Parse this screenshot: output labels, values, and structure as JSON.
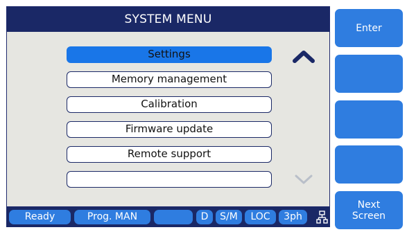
{
  "title": "SYSTEM MENU",
  "menu": {
    "items": [
      {
        "label": "Settings",
        "selected": true
      },
      {
        "label": "Memory management",
        "selected": false
      },
      {
        "label": "Calibration",
        "selected": false
      },
      {
        "label": "Firmware update",
        "selected": false
      },
      {
        "label": "Remote support",
        "selected": false
      },
      {
        "label": "",
        "selected": false
      }
    ],
    "scroll_up_icon": "chevron-up-icon",
    "scroll_down_icon": "chevron-down-icon"
  },
  "status_bar": {
    "items": [
      {
        "id": "ready",
        "label": "Ready"
      },
      {
        "id": "prog",
        "label": "Prog. MAN"
      },
      {
        "id": "blank",
        "label": ""
      },
      {
        "id": "d",
        "label": "D"
      },
      {
        "id": "sm",
        "label": "S/M"
      },
      {
        "id": "loc",
        "label": "LOC"
      },
      {
        "id": "phase",
        "label": "3ph"
      }
    ],
    "network_icon": "network-icon"
  },
  "softkeys": {
    "enter": "Enter",
    "key2": "",
    "key3": "",
    "key4": "",
    "next_screen_line1": "Next",
    "next_screen_line2": "Screen"
  },
  "colors": {
    "dark_navy": "#1a2866",
    "accent_blue": "#2f7de0",
    "selected_blue": "#1976e8",
    "panel_bg": "#e6e6e1"
  }
}
